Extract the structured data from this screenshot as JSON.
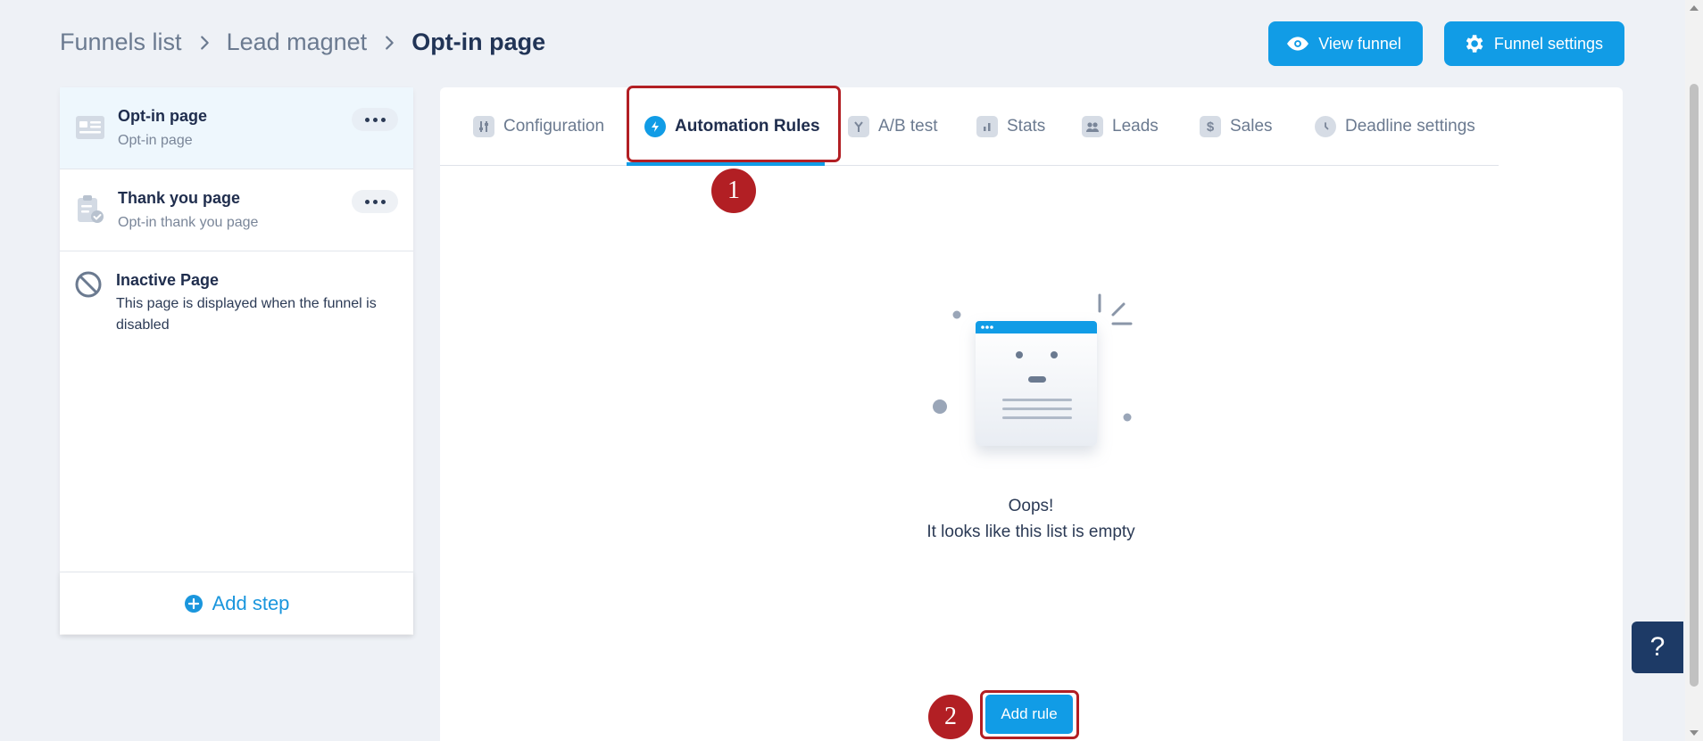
{
  "breadcrumb": {
    "items": [
      "Funnels list",
      "Lead magnet"
    ],
    "current": "Opt-in page"
  },
  "header": {
    "view_funnel": "View funnel",
    "funnel_settings": "Funnel settings"
  },
  "sidebar": {
    "steps": [
      {
        "title": "Opt-in page",
        "subtitle": "Opt-in page",
        "icon": "page-layout-icon"
      },
      {
        "title": "Thank you page",
        "subtitle": "Opt-in thank you page",
        "icon": "clipboard-check-icon"
      }
    ],
    "inactive": {
      "title": "Inactive Page",
      "description": "This page is displayed when the funnel is disabled",
      "icon": "block-icon"
    },
    "add_step": "Add step"
  },
  "tabs": [
    {
      "label": "Configuration",
      "icon": "sliders-icon"
    },
    {
      "label": "Automation Rules",
      "icon": "lightning-icon",
      "active": true
    },
    {
      "label": "A/B test",
      "icon": "split-icon"
    },
    {
      "label": "Stats",
      "icon": "bar-chart-icon"
    },
    {
      "label": "Leads",
      "icon": "users-icon"
    },
    {
      "label": "Sales",
      "icon": "dollar-icon"
    },
    {
      "label": "Deadline settings",
      "icon": "clock-icon"
    }
  ],
  "empty_state": {
    "title": "Oops!",
    "subtitle": "It looks like this list is empty"
  },
  "add_rule": "Add rule",
  "annotations": [
    "1",
    "2"
  ],
  "help": "?",
  "colors": {
    "primary": "#119ce6",
    "annotation": "#b21f24",
    "background": "#eef1f6"
  }
}
